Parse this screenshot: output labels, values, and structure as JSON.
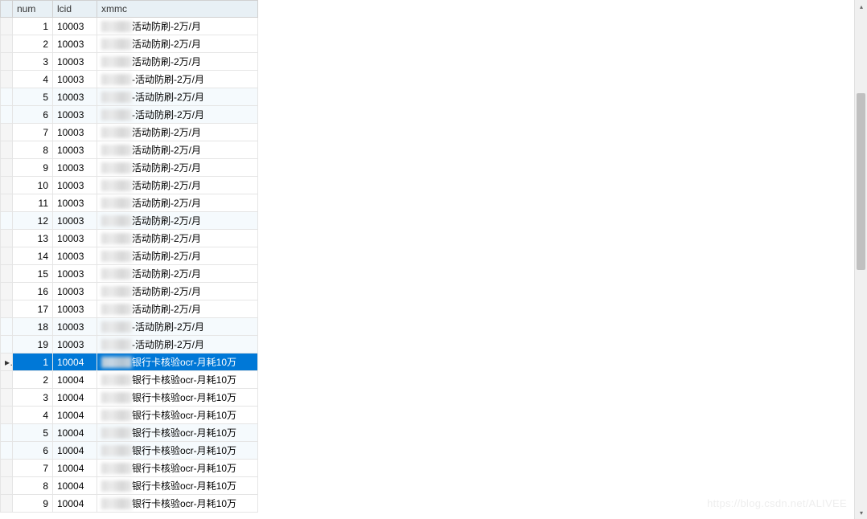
{
  "columns": {
    "num": "num",
    "lcid": "lcid",
    "xmmc": "xmmc"
  },
  "selected_index": 19,
  "selected_indicator": "▸",
  "rows": [
    {
      "num": "1",
      "lcid": "10003",
      "xmmc": "活动防刷-2万/月"
    },
    {
      "num": "2",
      "lcid": "10003",
      "xmmc": "活动防刷-2万/月"
    },
    {
      "num": "3",
      "lcid": "10003",
      "xmmc": "活动防刷-2万/月"
    },
    {
      "num": "4",
      "lcid": "10003",
      "xmmc": "-活动防刷-2万/月"
    },
    {
      "num": "5",
      "lcid": "10003",
      "xmmc": "-活动防刷-2万/月"
    },
    {
      "num": "6",
      "lcid": "10003",
      "xmmc": "-活动防刷-2万/月"
    },
    {
      "num": "7",
      "lcid": "10003",
      "xmmc": "活动防刷-2万/月"
    },
    {
      "num": "8",
      "lcid": "10003",
      "xmmc": "活动防刷-2万/月"
    },
    {
      "num": "9",
      "lcid": "10003",
      "xmmc": "活动防刷-2万/月"
    },
    {
      "num": "10",
      "lcid": "10003",
      "xmmc": "活动防刷-2万/月"
    },
    {
      "num": "11",
      "lcid": "10003",
      "xmmc": "活动防刷-2万/月"
    },
    {
      "num": "12",
      "lcid": "10003",
      "xmmc": "活动防刷-2万/月"
    },
    {
      "num": "13",
      "lcid": "10003",
      "xmmc": "活动防刷-2万/月"
    },
    {
      "num": "14",
      "lcid": "10003",
      "xmmc": "活动防刷-2万/月"
    },
    {
      "num": "15",
      "lcid": "10003",
      "xmmc": "活动防刷-2万/月"
    },
    {
      "num": "16",
      "lcid": "10003",
      "xmmc": "活动防刷-2万/月"
    },
    {
      "num": "17",
      "lcid": "10003",
      "xmmc": "活动防刷-2万/月"
    },
    {
      "num": "18",
      "lcid": "10003",
      "xmmc": "-活动防刷-2万/月"
    },
    {
      "num": "19",
      "lcid": "10003",
      "xmmc": "-活动防刷-2万/月"
    },
    {
      "num": "1",
      "lcid": "10004",
      "xmmc": "银行卡核验ocr-月耗10万"
    },
    {
      "num": "2",
      "lcid": "10004",
      "xmmc": "银行卡核验ocr-月耗10万"
    },
    {
      "num": "3",
      "lcid": "10004",
      "xmmc": "银行卡核验ocr-月耗10万"
    },
    {
      "num": "4",
      "lcid": "10004",
      "xmmc": "银行卡核验ocr-月耗10万"
    },
    {
      "num": "5",
      "lcid": "10004",
      "xmmc": "银行卡核验ocr-月耗10万"
    },
    {
      "num": "6",
      "lcid": "10004",
      "xmmc": "银行卡核验ocr-月耗10万"
    },
    {
      "num": "7",
      "lcid": "10004",
      "xmmc": "银行卡核验ocr-月耗10万"
    },
    {
      "num": "8",
      "lcid": "10004",
      "xmmc": "银行卡核验ocr-月耗10万"
    },
    {
      "num": "9",
      "lcid": "10004",
      "xmmc": "银行卡核验ocr-月耗10万"
    }
  ],
  "watermark": "https://blog.csdn.net/ALIVEE"
}
